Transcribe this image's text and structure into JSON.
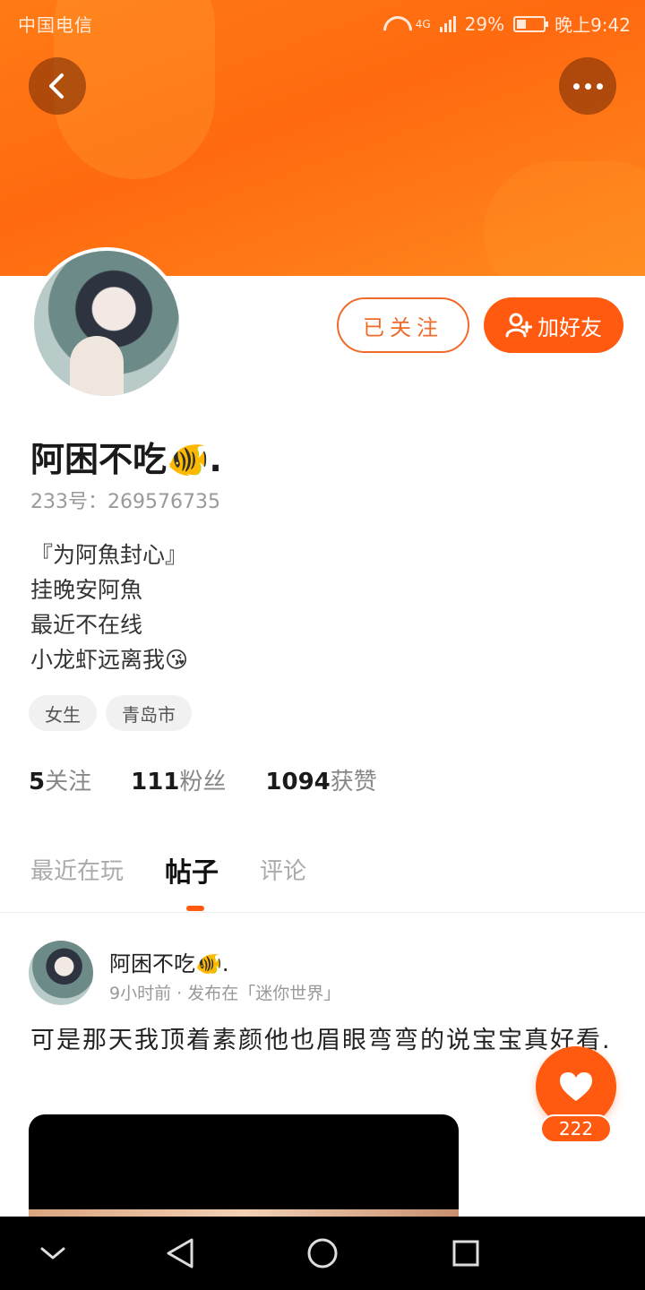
{
  "status_bar": {
    "carrier": "中国电信",
    "network": "4G",
    "battery": "29%",
    "time": "晚上9:42"
  },
  "header": {
    "back_icon": "chevron-left-icon",
    "more_icon": "more-dots-icon"
  },
  "profile": {
    "username": "阿困不吃🐠.",
    "id_label": "233号：",
    "id_value": "269576735",
    "bio_lines": [
      "『为阿魚封心』",
      "挂晚安阿魚",
      "最近不在线",
      "小龙虾远离我😘"
    ],
    "tags": [
      "女生",
      "青岛市"
    ],
    "stats": [
      {
        "num": "5",
        "label": "关注"
      },
      {
        "num": "111",
        "label": "粉丝"
      },
      {
        "num": "1094",
        "label": "获赞"
      }
    ]
  },
  "actions": {
    "followed_label": "已关注",
    "add_friend_label": "加好友"
  },
  "tabs": [
    {
      "label": "最近在玩",
      "active": false
    },
    {
      "label": "帖子",
      "active": true
    },
    {
      "label": "评论",
      "active": false
    }
  ],
  "post": {
    "author": "阿困不吃🐠.",
    "meta": "9小时前 · 发布在「迷你世界」",
    "text": "可是那天我顶着素颜他也眉眼弯弯的说宝宝真好看."
  },
  "like": {
    "count": "222"
  },
  "colors": {
    "accent": "#ff5a10",
    "banner": "#ff7a14"
  }
}
